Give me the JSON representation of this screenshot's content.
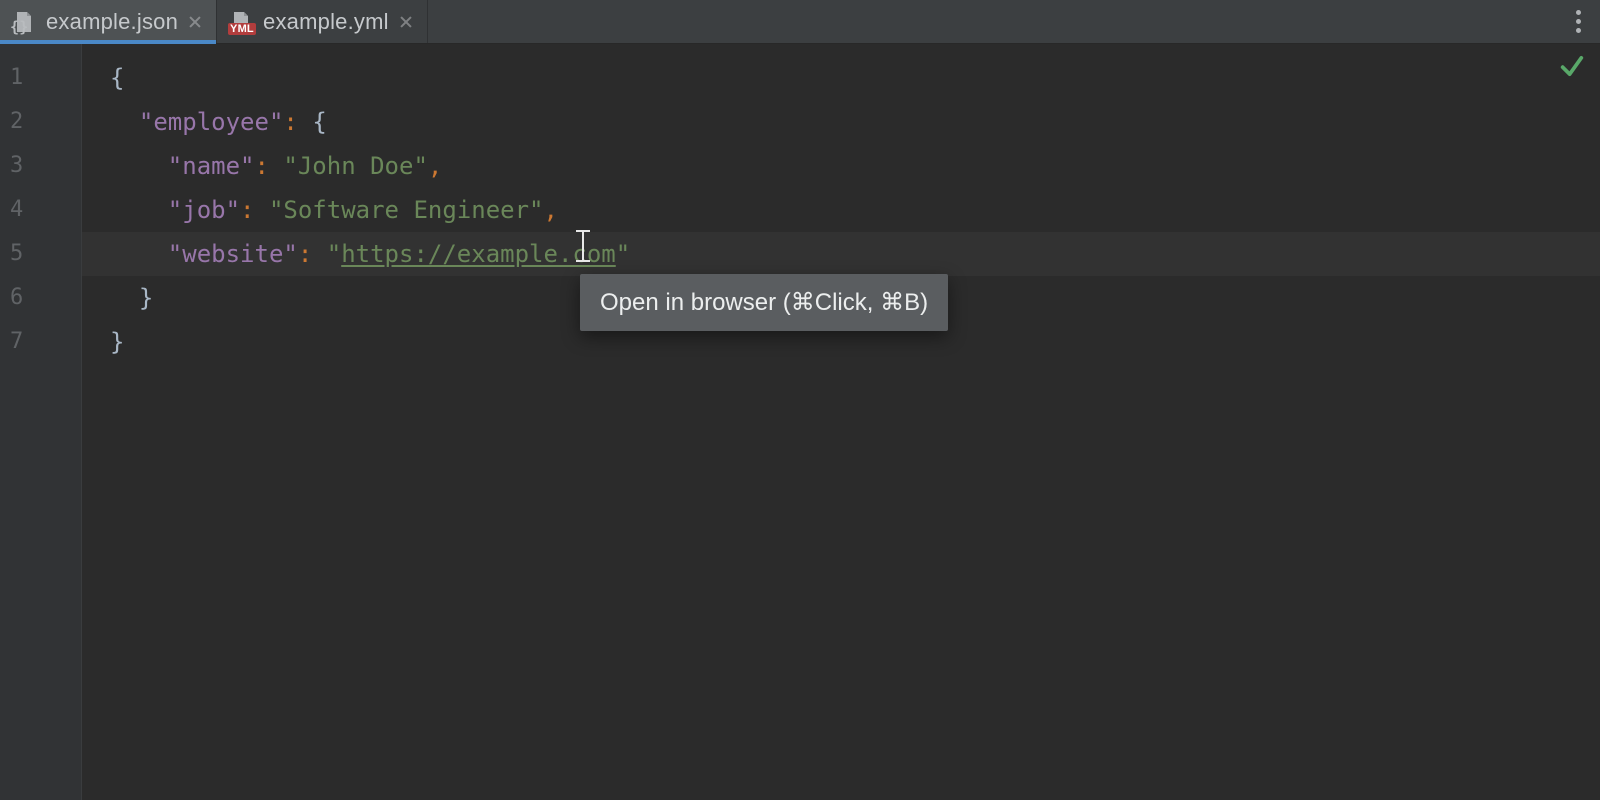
{
  "tabs": [
    {
      "label": "example.json",
      "icon": "json",
      "active": true
    },
    {
      "label": "example.yml",
      "icon": "yml",
      "active": false
    }
  ],
  "gutter": {
    "lines": [
      "1",
      "2",
      "3",
      "4",
      "5",
      "6",
      "7"
    ]
  },
  "code": {
    "l1": {
      "brace_open": "{"
    },
    "l2": {
      "key": "\"employee\"",
      "colon": ": ",
      "brace_open": "{"
    },
    "l3": {
      "key": "\"name\"",
      "colon": ": ",
      "val": "\"John Doe\"",
      "comma": ","
    },
    "l4": {
      "key": "\"job\"",
      "colon": ": ",
      "val": "\"Software Engineer\"",
      "comma": ","
    },
    "l5": {
      "key": "\"website\"",
      "colon": ": ",
      "q1": "\"",
      "url": "https://example.com",
      "q2": "\""
    },
    "l6": {
      "brace_close": "}"
    },
    "l7": {
      "brace_close": "}"
    }
  },
  "tooltip": {
    "text": "Open in browser (⌘Click, ⌘B)"
  },
  "status": {
    "inspections": "ok"
  },
  "colors": {
    "accent": "#4a88c7",
    "ok": "#59a869"
  }
}
